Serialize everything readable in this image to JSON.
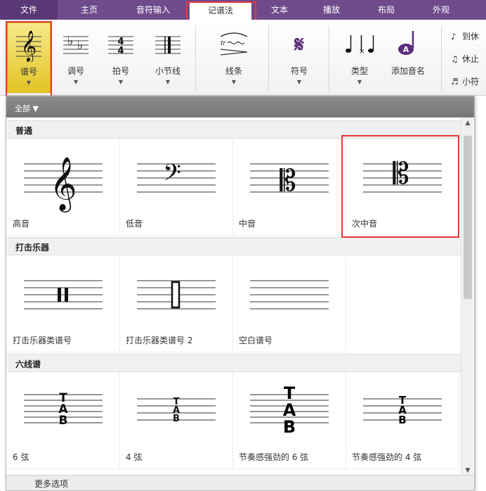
{
  "tabs": [
    {
      "id": "file",
      "label": "文件"
    },
    {
      "id": "home",
      "label": "主页"
    },
    {
      "id": "note_input",
      "label": "音符输入"
    },
    {
      "id": "notations",
      "label": "记谱法"
    },
    {
      "id": "text",
      "label": "文本"
    },
    {
      "id": "play",
      "label": "播放"
    },
    {
      "id": "layout",
      "label": "布局"
    },
    {
      "id": "appearance",
      "label": "外观"
    }
  ],
  "active_tab": "记谱法",
  "ribbon": {
    "clef": "谱号",
    "key": "调号",
    "time": "拍号",
    "barline": "小节线",
    "lines": "线条",
    "symbols": "符号",
    "type": "类型",
    "add_note_name": "添加音名",
    "side_commands": [
      "到休",
      "休止",
      "小符"
    ]
  },
  "panel": {
    "filter_label": "全部",
    "sections": [
      {
        "title": "普通",
        "items": [
          "高音",
          "低音",
          "中音",
          "次中音"
        ]
      },
      {
        "title": "打击乐器",
        "items": [
          "打击乐器类谱号",
          "打击乐器类谱号 2",
          "空白谱号"
        ]
      },
      {
        "title": "六线谱",
        "items": [
          "6 弦",
          "4 弦",
          "节奏感强劲的 6 弦",
          "节奏感强劲的 4 弦"
        ]
      }
    ],
    "more_options": "更多选项"
  },
  "colors": {
    "tab_bar": "#6f4b8c",
    "file_tab": "#5a3876",
    "highlight_box": "#e23a3a",
    "active_button": "#e3c424"
  }
}
